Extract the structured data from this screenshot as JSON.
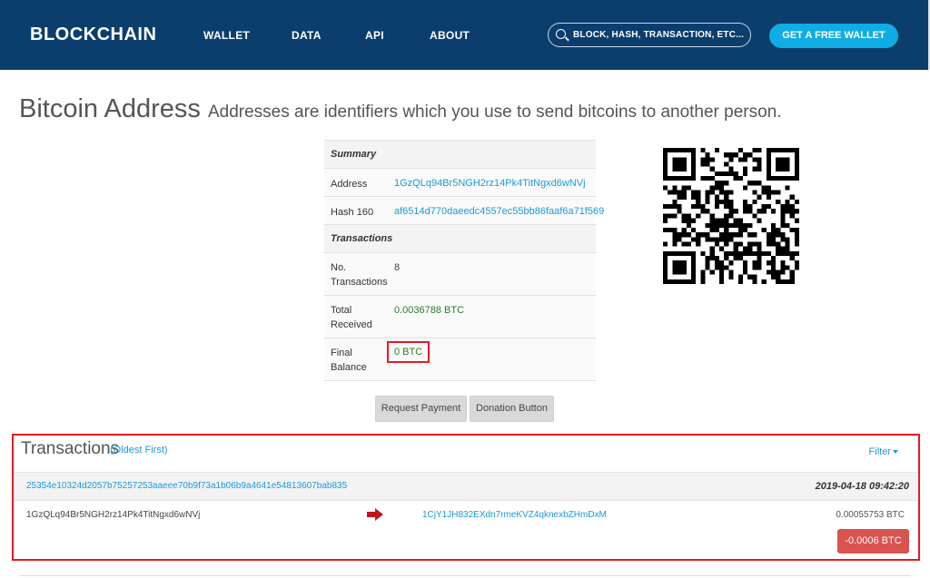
{
  "header": {
    "logo": "BLOCKCHAIN",
    "nav": [
      "WALLET",
      "DATA",
      "API",
      "ABOUT"
    ],
    "search_placeholder": "BLOCK, HASH, TRANSACTION, ETC...",
    "cta_label": "GET A FREE WALLET",
    "bg_color": "#0b3e6d",
    "cta_color": "#10ade4"
  },
  "page": {
    "title": "Bitcoin Address",
    "subtitle": "Addresses are identifiers which you use to send bitcoins to another person."
  },
  "summary": {
    "section_summary": "Summary",
    "address_label": "Address",
    "address_value": "1GzQLq94Br5NGH2rz14Pk4TitNgxd6wNVj",
    "hash160_label": "Hash 160",
    "hash160_value": "af6514d770daeedc4557ec55bb86faaf6a71f569",
    "section_transactions": "Transactions",
    "num_tx_label": "No. Transactions",
    "num_tx_value": "8",
    "total_received_label": "Total Received",
    "total_received_value": "0.0036788 BTC",
    "final_balance_label": "Final Balance",
    "final_balance_value": "0 BTC"
  },
  "buttons": {
    "request_payment": "Request Payment",
    "donation_button": "Donation Button"
  },
  "transactions": {
    "title": "Transactions",
    "order": "(Oldest First)",
    "filter_label": "Filter",
    "items": [
      {
        "hash": "25354e10324d2057b75257253aaeee70b9f73a1b06b9a4641e54813607bab835",
        "time": "2019-04-18 09:42:20",
        "from": "1GzQLq94Br5NGH2rz14Pk4TitNgxd6wNVj",
        "to": "1CjY1JH832EXdn7rmeKVZ4qknexbZHmDxM",
        "amount": "0.00055753 BTC",
        "total": "-0.0006 BTC"
      }
    ]
  },
  "colors": {
    "link": "#1a9bd7",
    "positive": "#2a7d2a",
    "negative_badge": "#d9534f",
    "highlight_border": "#e31b23"
  }
}
